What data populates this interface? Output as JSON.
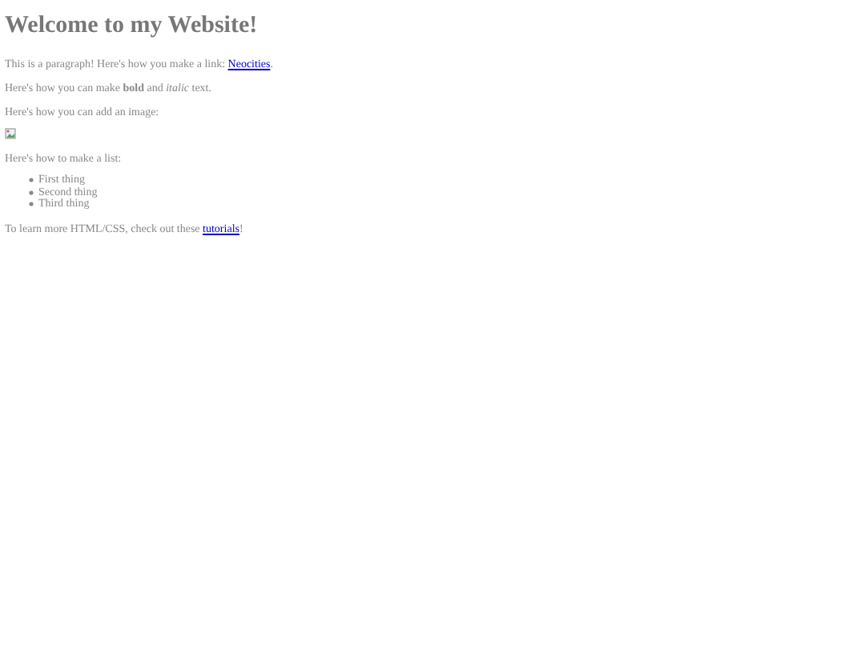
{
  "heading": "Welcome to my Website!",
  "link_paragraph": {
    "before": "This is a paragraph! Here's how you make a link: ",
    "link": "Neocities",
    "after": "."
  },
  "format_paragraph": "Here's how you can make **bold** and *italic* text.",
  "image_paragraph": "Here's how you can add an image:",
  "image": {
    "kind": "broken-image"
  },
  "list_intro": "Here's how to make a list:",
  "list_items": [
    "First thing",
    "Second thing",
    "Third thing"
  ],
  "closing_paragraph": {
    "before": "To learn more HTML/CSS, check out these ",
    "link": "tutorials",
    "after": "!"
  }
}
